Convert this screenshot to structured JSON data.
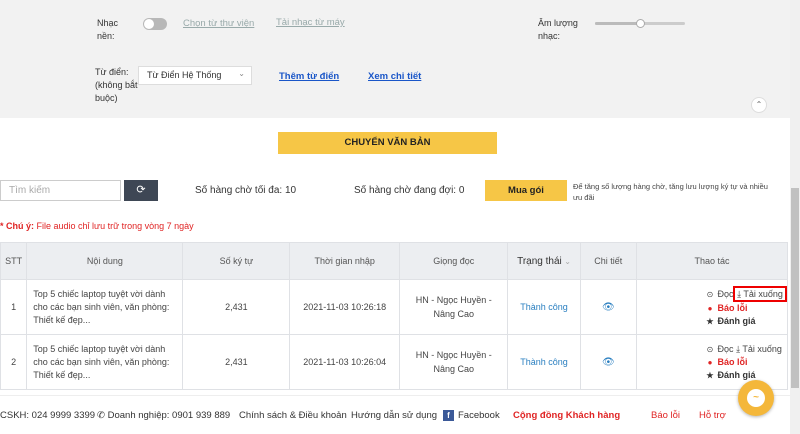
{
  "settings": {
    "music_label": "Nhạc nền:",
    "music_library_link": "Chọn từ thư viện",
    "music_upload_link": "Tải nhạc từ máy",
    "volume_label": "Âm lượng nhạc:",
    "volume_level": 0.5,
    "dictionary_label": "Từ điển: (không bắt buộc)",
    "dictionary_value": "Từ Điển Hệ Thống",
    "add_word_link": "Thêm từ điển",
    "view_detail_link": "Xem chi tiết"
  },
  "convert_button": "CHUYỂN VĂN BẢN",
  "toolbar": {
    "search_placeholder": "Tìm kiếm",
    "max_queue": "Số hàng chờ tối đa: 10",
    "waiting_queue": "Số hàng chờ đang đợi: 0",
    "buy_button": "Mua gói",
    "buy_note": "Để tăng số lượng hàng chờ, tăng lưu lượng ký tự và nhiều ưu đãi"
  },
  "notice": {
    "prefix": "* Chú ý:",
    "text": " File audio chỉ lưu trữ trong vòng 7 ngày"
  },
  "table": {
    "headers": {
      "stt": "STT",
      "content": "Nội dung",
      "chars": "Số ký tự",
      "time": "Thời gian nhập",
      "voice": "Giọng đọc",
      "status": "Trạng thái",
      "detail": "Chi tiết",
      "actions": "Thao tác"
    },
    "rows": [
      {
        "stt": "1",
        "content": "Top 5 chiếc laptop tuyệt vời dành cho các bạn sinh viên, văn phòng: Thiết kế đẹp...",
        "chars": "2,431",
        "time": "2021-11-03 10:26:18",
        "voice": "HN - Ngọc Huyền - Nâng Cao",
        "status": "Thành công"
      },
      {
        "stt": "2",
        "content": "Top 5 chiếc laptop tuyệt vời dành cho các bạn sinh viên, văn phòng: Thiết kế đẹp...",
        "chars": "2,431",
        "time": "2021-11-03 10:26:04",
        "voice": "HN - Ngọc Huyền - Nâng Cao",
        "status": "Thành công"
      }
    ],
    "actions": {
      "read": "Đọc",
      "download": "Tải xuống",
      "report": "Báo lỗi",
      "rate": "Đánh giá"
    }
  },
  "footer": {
    "hotline": "CSKH: 024 9999 3399",
    "business": "Doanh nghiệp: 0901 939 889",
    "policy": "Chính sách & Điều khoản",
    "guide": "Hướng dẫn sử dụng",
    "facebook": "Facebook",
    "community": "Cộng đồng Khách hàng",
    "report": "Báo lỗi",
    "support": "Hỗ trợ"
  },
  "colors": {
    "accent_yellow": "#f6c646",
    "link_blue": "#2a7fc0",
    "alert_red": "#e02424",
    "dark_button": "#3e4755"
  }
}
